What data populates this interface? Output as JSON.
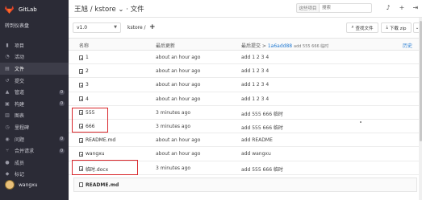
{
  "app": {
    "name": "GitLab"
  },
  "sidebar": {
    "back_label": "转到仪表盘",
    "items": [
      {
        "label": "项目",
        "icon": "bookmark-icon",
        "count": null
      },
      {
        "label": "活动",
        "icon": "activity-icon",
        "count": null
      },
      {
        "label": "文件",
        "icon": "files-icon",
        "count": null
      },
      {
        "label": "提交",
        "icon": "history-icon",
        "count": null
      },
      {
        "label": "管道",
        "icon": "rocket-icon",
        "count": "0"
      },
      {
        "label": "构建",
        "icon": "cubes-icon",
        "count": "0"
      },
      {
        "label": "图表",
        "icon": "chart-icon",
        "count": null
      },
      {
        "label": "里程碑",
        "icon": "milestone-icon",
        "count": null
      },
      {
        "label": "问题",
        "icon": "issue-icon",
        "count": "0"
      },
      {
        "label": "合并请求",
        "icon": "merge-icon",
        "count": "0"
      },
      {
        "label": "成员",
        "icon": "users-icon",
        "count": null
      },
      {
        "label": "标记",
        "icon": "tag-icon",
        "count": null
      }
    ],
    "user": {
      "name": "wangxu"
    }
  },
  "header": {
    "breadcrumb": "王旭 / kstore ⌄ · 文件",
    "search_scope": "这些项目",
    "search_placeholder": "搜索",
    "icons": [
      "bell-icon",
      "plus-icon",
      "sign-out-icon"
    ]
  },
  "toolbar": {
    "ref": "v1.0",
    "path": "kstore /",
    "path_add": "+",
    "find_file_label": "查找文件",
    "download_label": "下载 zip",
    "more_label": "⌄"
  },
  "table": {
    "headers": {
      "name": "名称",
      "updated": "最后更新",
      "last_commit": "最后提交",
      "commit_id": "1a6add88",
      "commit_msg": "add 555 666 临时",
      "history": "历史"
    },
    "rows": [
      {
        "name": "1",
        "updated": "about an hour ago",
        "message": "add 1 2 3 4"
      },
      {
        "name": "2",
        "updated": "about an hour ago",
        "message": "add 1 2 3 4"
      },
      {
        "name": "3",
        "updated": "about an hour ago",
        "message": "add 1 2 3 4"
      },
      {
        "name": "4",
        "updated": "about an hour ago",
        "message": "add 1 2 3 4"
      },
      {
        "name": "555",
        "updated": "3 minutes ago",
        "message": "add 555 666 临时"
      },
      {
        "name": "666",
        "updated": "3 minutes ago",
        "message": "add 555 666 临时"
      },
      {
        "name": "README.md",
        "updated": "about an hour ago",
        "message": "add README"
      },
      {
        "name": "wangxu",
        "updated": "about an hour ago",
        "message": "add wangxu"
      },
      {
        "name": "临时.docx",
        "updated": "3 minutes ago",
        "message": "add 555 666 临时"
      }
    ]
  },
  "readme": {
    "label": "README.md"
  },
  "colors": {
    "sidebar_bg": "#2b2b36",
    "link": "#1f78d1",
    "highlight": "#d9262b"
  }
}
